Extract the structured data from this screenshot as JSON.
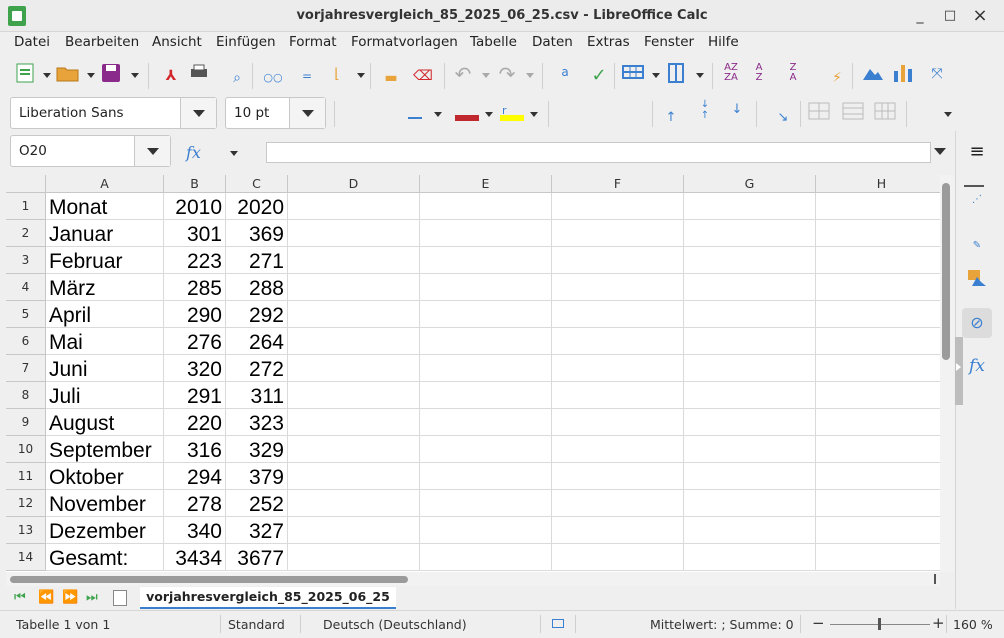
{
  "window": {
    "title": "vorjahresvergleich_85_2025_06_25.csv - LibreOffice Calc",
    "minimize": "_",
    "maximize": "□",
    "close": "×"
  },
  "menu": [
    "Datei",
    "Bearbeiten",
    "Ansicht",
    "Einfügen",
    "Format",
    "Formatvorlagen",
    "Tabelle",
    "Daten",
    "Extras",
    "Fenster",
    "Hilfe"
  ],
  "toolbar": {
    "font_name": "Liberation Sans",
    "font_size": "10 pt"
  },
  "formula_bar": {
    "cell_ref": "O20",
    "fx": "fx",
    "content": ""
  },
  "grid": {
    "columns": [
      "A",
      "B",
      "C",
      "D",
      "E",
      "F",
      "G",
      "H"
    ],
    "row_numbers": [
      "1",
      "2",
      "3",
      "4",
      "5",
      "6",
      "7",
      "8",
      "9",
      "10",
      "11",
      "12",
      "13",
      "14"
    ],
    "rows": [
      [
        "Monat",
        "2010",
        "2020"
      ],
      [
        "Januar",
        "301",
        "369"
      ],
      [
        "Februar",
        "223",
        "271"
      ],
      [
        "März",
        "285",
        "288"
      ],
      [
        "April",
        "290",
        "292"
      ],
      [
        "Mai",
        "276",
        "264"
      ],
      [
        "Juni",
        "320",
        "272"
      ],
      [
        "Juli",
        "291",
        "311"
      ],
      [
        "August",
        "220",
        "323"
      ],
      [
        "September",
        "316",
        "329"
      ],
      [
        "Oktober",
        "294",
        "379"
      ],
      [
        "November",
        "278",
        "252"
      ],
      [
        "Dezember",
        "340",
        "327"
      ],
      [
        "Gesamt:",
        "3434",
        "3677"
      ]
    ]
  },
  "sheet_tab": "vorjahresvergleich_85_2025_06_25",
  "status": {
    "sheet": "Tabelle 1 von 1",
    "style": "Standard",
    "language": "Deutsch (Deutschland)",
    "summary": "Mittelwert: ; Summe: 0",
    "zoom": "160 %",
    "zoom_minus": "−",
    "zoom_plus": "+"
  },
  "colors": {
    "accent": "#3a7fd0",
    "font_color": "#c0282d",
    "highlight": "#ffff00",
    "app_green": "#3fa34d"
  }
}
